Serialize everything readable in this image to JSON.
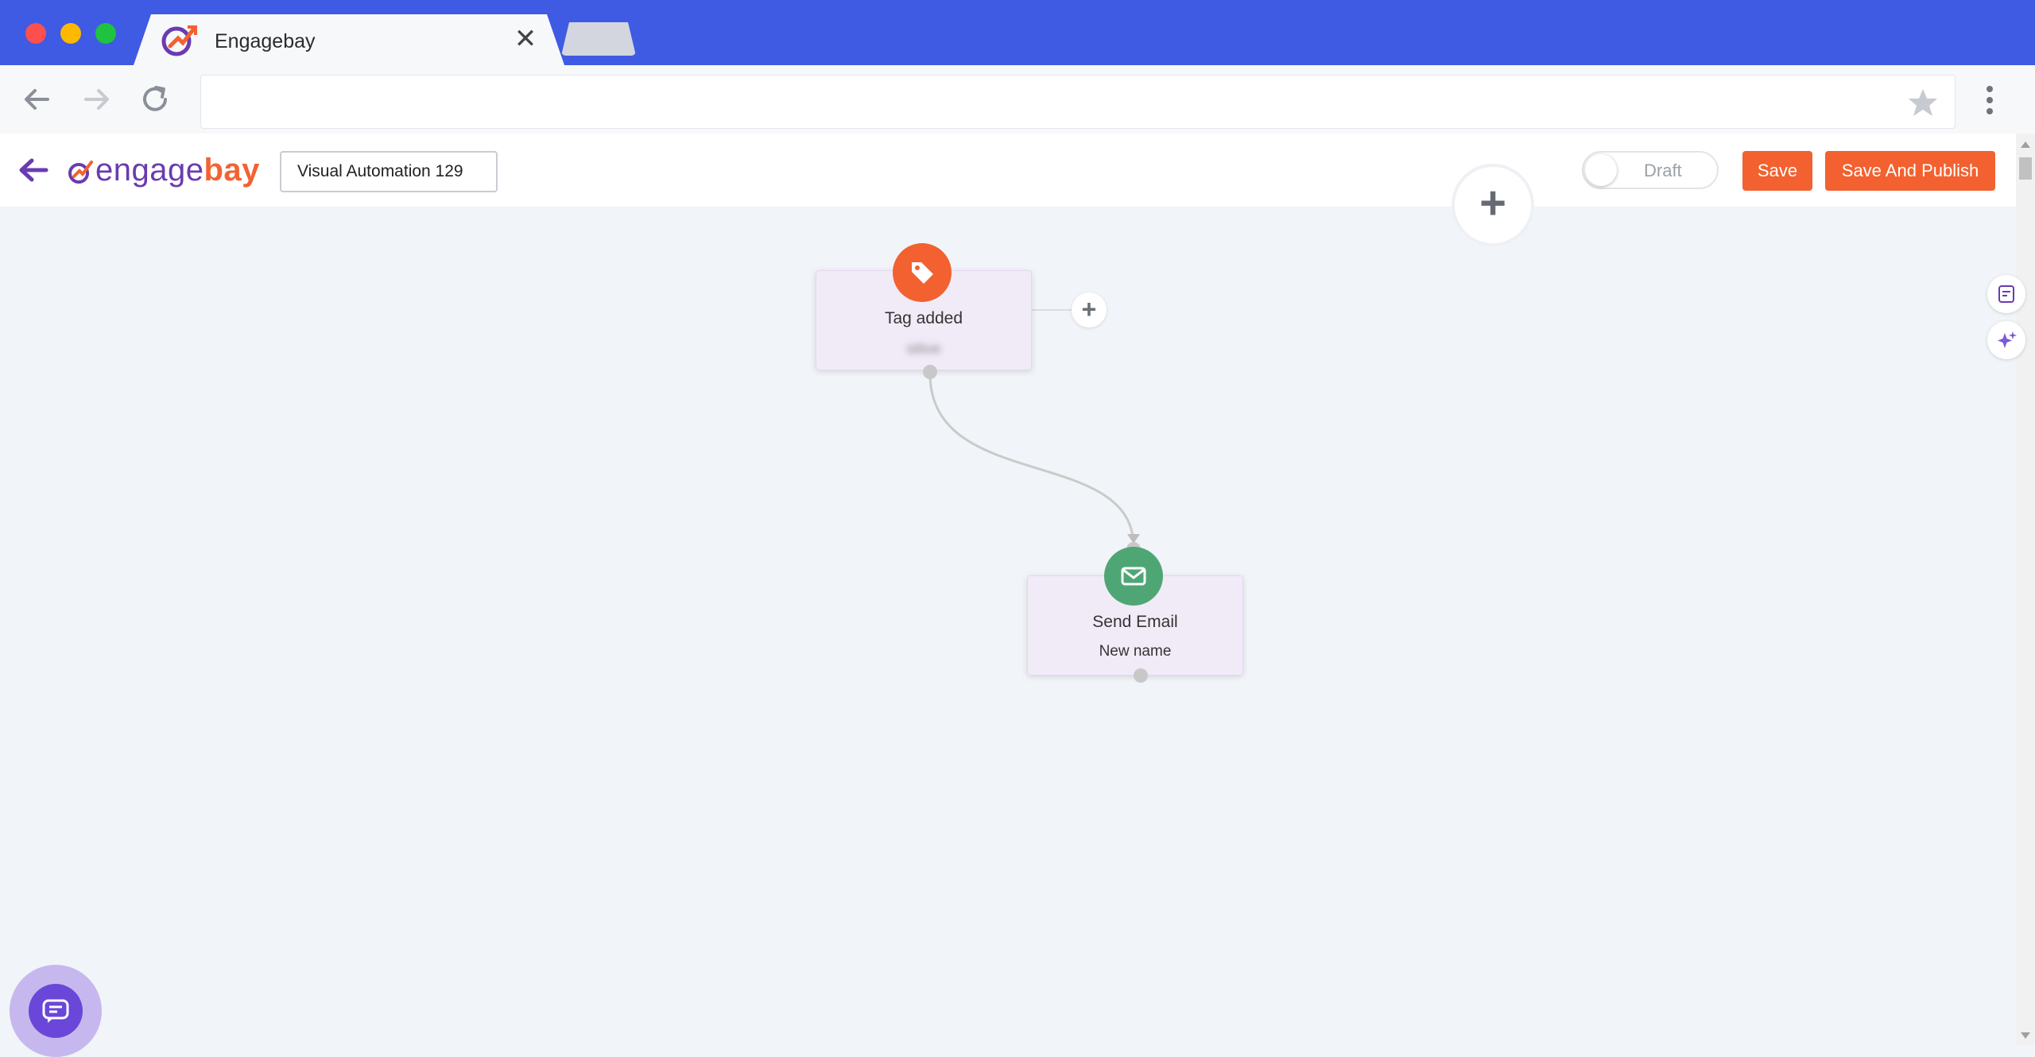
{
  "browser": {
    "tab_title": "Engagebay",
    "tab_close": "✕",
    "address": ""
  },
  "app": {
    "logo_engage": "engage",
    "logo_bay": "bay",
    "automation_name": "Visual Automation 129",
    "status_toggle_label": "Draft",
    "status_toggle_on": false,
    "save_label": "Save",
    "publish_label": "Save And Publish"
  },
  "canvas": {
    "add_plus": "+",
    "nodes": [
      {
        "title": "Tag added",
        "subtitle": "sitive",
        "icon": "tag-icon",
        "color": "#f2612f"
      },
      {
        "title": "Send Email",
        "subtitle": "New name",
        "icon": "envelope-icon",
        "color": "#4fa675"
      }
    ],
    "node_plus": "+"
  },
  "colors": {
    "brand_blue": "#3f5ae3",
    "accent_orange": "#f2612f",
    "brand_purple": "#6a3bb0",
    "email_green": "#4fa675"
  }
}
